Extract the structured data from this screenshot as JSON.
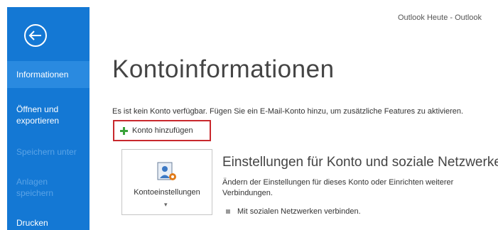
{
  "window": {
    "title": "Outlook Heute - Outlook"
  },
  "colors": {
    "sidebar": "#1478d4",
    "sidebar_selected": "#2a8ae0",
    "highlight_box": "#c8282d",
    "add_icon": "#3aa23a"
  },
  "sidebar": {
    "back_icon": "back-arrow-icon",
    "items": [
      {
        "label": "Informationen",
        "state": "selected"
      },
      {
        "label": "Öffnen und\nexportieren",
        "state": "enabled"
      },
      {
        "label": "Speichern unter",
        "state": "disabled"
      },
      {
        "label": "Anlagen\nspeichern",
        "state": "disabled"
      },
      {
        "label": "Drucken",
        "state": "enabled"
      }
    ]
  },
  "main": {
    "title": "Kontoinformationen",
    "info_text": "Es ist kein Konto verfügbar. Fügen Sie ein E-Mail-Konto hinzu, um zusätzliche Features zu aktivieren.",
    "add_account": {
      "label": "Konto hinzufügen",
      "icon": "plus-icon"
    },
    "account_settings": {
      "tile_label": "Kontoeinstellungen",
      "tile_icon": "account-settings-icon",
      "heading": "Einstellungen für Konto und soziale Netzwerke",
      "description": "Ändern der Einstellungen für dieses Konto oder Einrichten weiterer Verbindungen.",
      "bullet": "Mit sozialen Netzwerken verbinden."
    }
  }
}
